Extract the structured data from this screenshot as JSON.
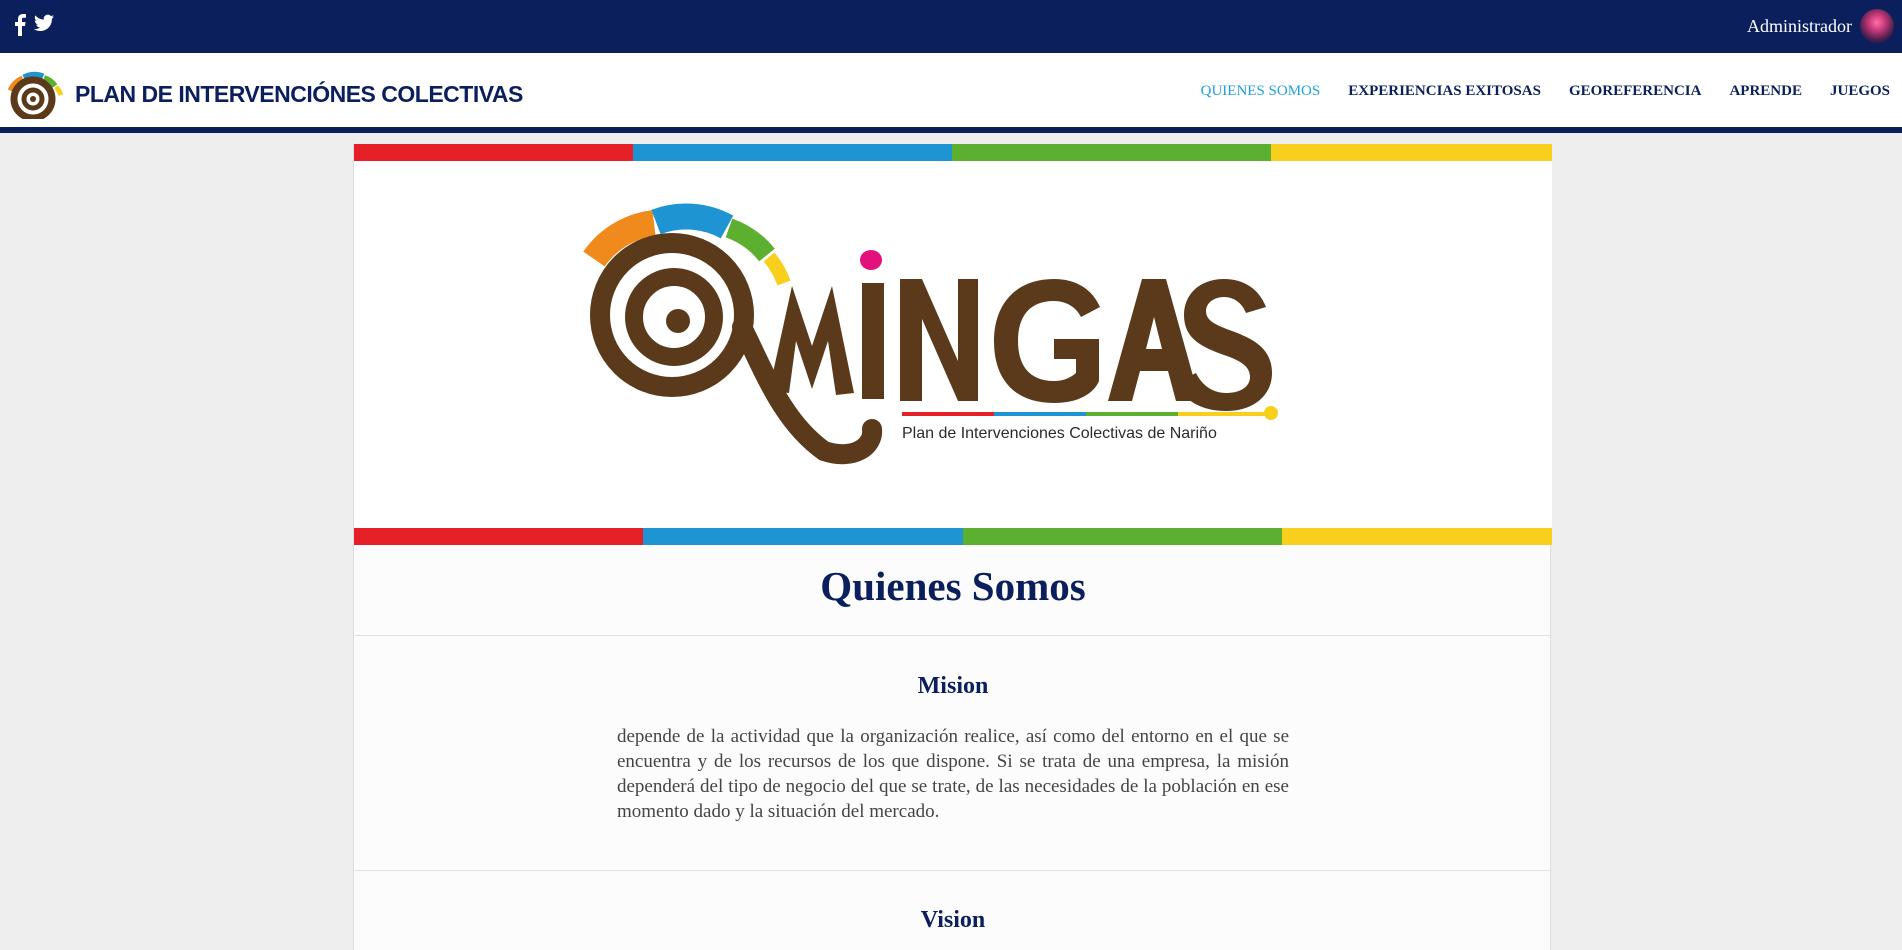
{
  "topbar": {
    "social_icons": [
      "facebook-icon",
      "twitter-icon"
    ],
    "admin_label": "Administrador",
    "colors": {
      "background": "#0a1f5c",
      "text": "#ffffff"
    }
  },
  "navbar": {
    "brand": "PLAN DE INTERVENCIÓNES COLECTIVAS",
    "menu": [
      {
        "label": "QUIENES SOMOS",
        "active": true
      },
      {
        "label": "EXPERIENCIAS EXITOSAS",
        "active": false
      },
      {
        "label": "GEOREFERENCIA",
        "active": false
      },
      {
        "label": "APRENDE",
        "active": false
      },
      {
        "label": "JUEGOS",
        "active": false
      }
    ],
    "colors": {
      "active": "#1f9fdc",
      "text": "#0a1f5c"
    }
  },
  "banner": {
    "logo_text": "MINGAS",
    "logo_subtitle": "Plan de Intervenciones Colectivas de Nariño",
    "colors": {
      "red": "#e52026",
      "blue": "#1f94d2",
      "green": "#5caf2f",
      "yellow": "#f8cf1d",
      "brown": "#5a3a1a",
      "orange": "#f08a1c",
      "magenta": "#e2127c"
    }
  },
  "content": {
    "title": "Quienes Somos",
    "mision": {
      "title": "Mision",
      "text": "depende de la actividad que la organización realice, así como del entorno en el que se encuentra y de los recursos de los que dispone. Si se trata de una empresa, la misión dependerá del tipo de negocio del que se trate, de las necesidades de la población en ese momento dado y la situación del mercado."
    },
    "vision": {
      "title": "Vision"
    }
  }
}
